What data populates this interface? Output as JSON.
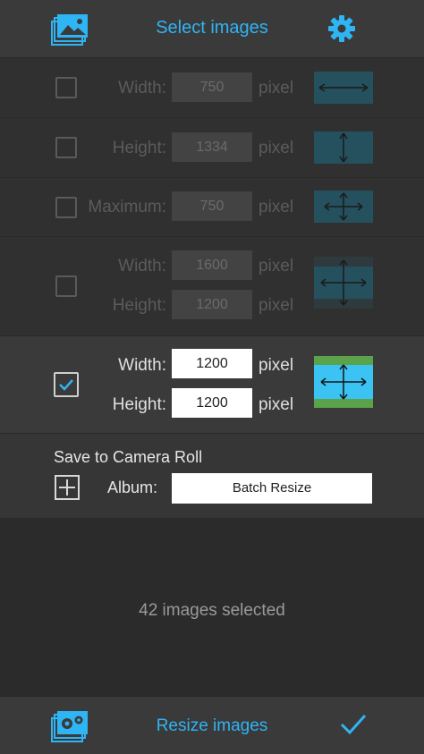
{
  "header": {
    "title": "Select images",
    "left_icon": "images-stack-icon",
    "right_icon": "gear-icon"
  },
  "options": [
    {
      "checked": false,
      "fields": [
        {
          "label": "Width:",
          "value": "750",
          "unit": "pixel"
        }
      ]
    },
    {
      "checked": false,
      "fields": [
        {
          "label": "Height:",
          "value": "1334",
          "unit": "pixel"
        }
      ]
    },
    {
      "checked": false,
      "fields": [
        {
          "label": "Maximum:",
          "value": "750",
          "unit": "pixel"
        }
      ]
    },
    {
      "checked": false,
      "fields": [
        {
          "label": "Width:",
          "value": "1600",
          "unit": "pixel"
        },
        {
          "label": "Height:",
          "value": "1200",
          "unit": "pixel"
        }
      ]
    },
    {
      "checked": true,
      "fields": [
        {
          "label": "Width:",
          "value": "1200",
          "unit": "pixel"
        },
        {
          "label": "Height:",
          "value": "1200",
          "unit": "pixel"
        }
      ]
    }
  ],
  "save": {
    "title": "Save to Camera Roll",
    "album_label": "Album:",
    "album_value": "Batch Resize"
  },
  "status": {
    "count_text": "42 images selected"
  },
  "footer": {
    "title": "Resize images",
    "left_icon": "images-gear-icon",
    "right_icon": "checkmark-icon"
  },
  "colors": {
    "accent": "#2fb4f4",
    "preview_blue": "#3bc3f4",
    "preview_green": "#5aa34a"
  }
}
